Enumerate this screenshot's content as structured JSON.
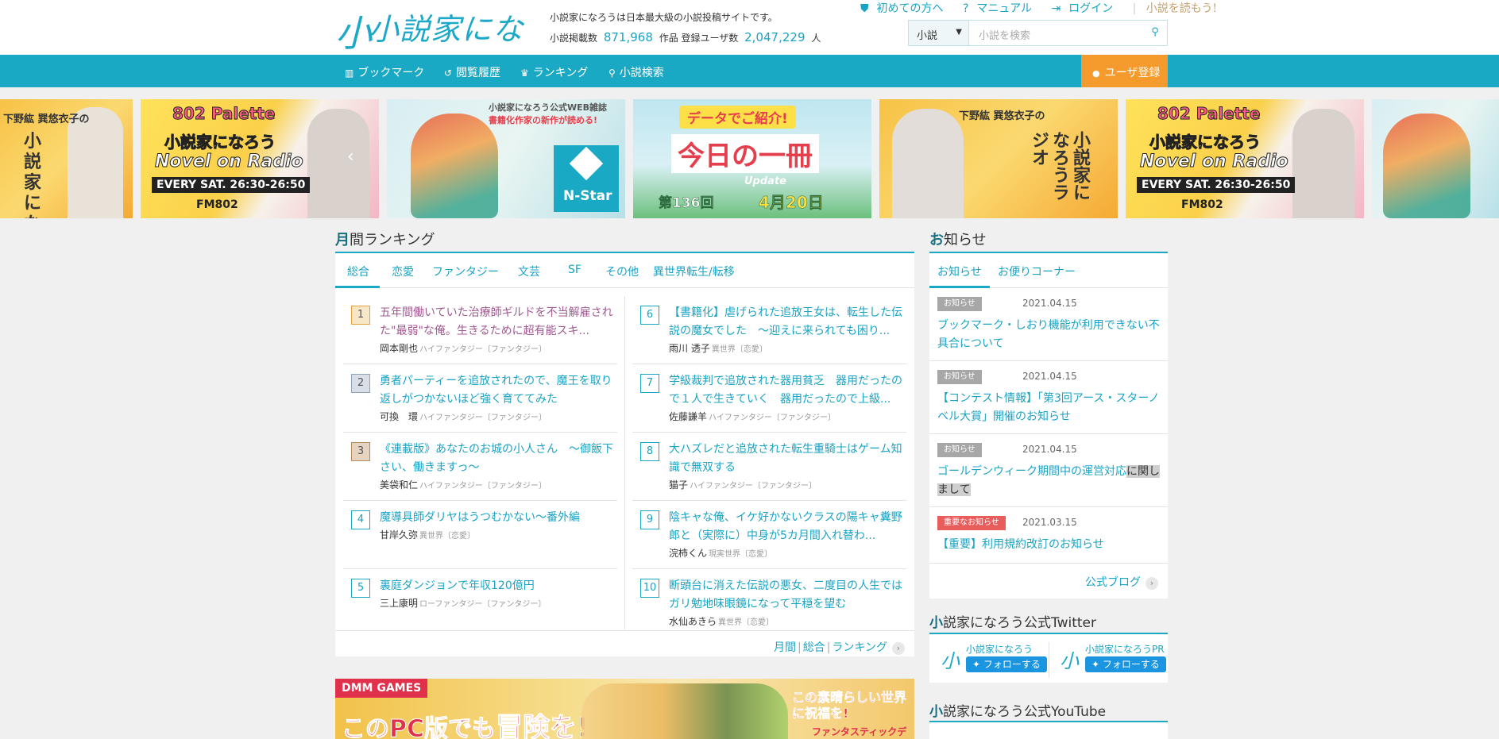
{
  "header": {
    "logo_text": "小説家になろう",
    "description": "小説家になろうは日本最大級の小説投稿サイトです。",
    "stats_novels_label": "小説掲載数",
    "stats_novels_value": "871,968",
    "stats_novels_unit": "作品",
    "stats_users_label": "登録ユーザ数",
    "stats_users_value": "2,047,229",
    "stats_users_unit": "人",
    "links": {
      "beginner": "初めての方へ",
      "manual": "マニュアル",
      "login": "ログイン",
      "read": "小説を読もう!"
    },
    "search": {
      "category": "小説",
      "placeholder": "小説を検索"
    }
  },
  "nav": {
    "bookmark": "ブックマーク",
    "history": "閲覧履歴",
    "ranking": "ランキング",
    "search": "小説検索",
    "register": "ユーザ登録"
  },
  "banners": {
    "radio_a": {
      "hosts": "下野紘 巽悠衣子の",
      "title": "小説家になろうラジオ"
    },
    "palette_a": {
      "brand": "802 Palette",
      "title": "小説家になろう",
      "subtitle": "Novel on Radio",
      "schedule": "EVERY SAT. 26:30-26:50",
      "station": "FM802"
    },
    "nstar": {
      "caption": "小説家になろう公式WEB雑誌",
      "caption2": "書籍化作家の新作が読める!",
      "brand": "N-Star"
    },
    "today": {
      "caption": "データでご紹介!",
      "title": "今日の一冊",
      "update": "Update",
      "issue": "第136回",
      "date": "4月20日"
    },
    "radio_b": {
      "hosts": "下野紘 巽悠衣子の",
      "title": "小説家になろうラジオ"
    },
    "palette_b": {
      "brand": "802 Palette",
      "title": "小説家になろう",
      "subtitle": "Novel on Radio",
      "schedule": "EVERY SAT. 26:30-26:50",
      "station": "FM802"
    }
  },
  "ranking": {
    "title_prefix": "月",
    "title_rest": "間ランキング",
    "tabs": [
      "総合",
      "恋愛",
      "ファンタジー",
      "文芸",
      "SF",
      "その他",
      "異世界転生/転移"
    ],
    "items": [
      {
        "rank": "1",
        "title": "五年間働いていた治療師ギルドを不当解雇された\"最弱\"な俺。生きるために超有能スキ...",
        "author": "岡本剛也",
        "genre": "ハイファンタジー〔ファンタジー〕"
      },
      {
        "rank": "2",
        "title": "勇者パーティーを追放されたので、魔王を取り返しがつかないほど強く育ててみた",
        "author": "可換　環",
        "genre": "ハイファンタジー〔ファンタジー〕"
      },
      {
        "rank": "3",
        "title": "《連載版》あなたのお城の小人さん　～御飯下さい、働きますっ～",
        "author": "美袋和仁",
        "genre": "ハイファンタジー〔ファンタジー〕"
      },
      {
        "rank": "4",
        "title": "魔導具師ダリヤはうつむかない～番外編",
        "author": "甘岸久弥",
        "genre": "異世界〔恋愛〕"
      },
      {
        "rank": "5",
        "title": "裏庭ダンジョンで年収120億円",
        "author": "三上康明",
        "genre": "ローファンタジー〔ファンタジー〕"
      },
      {
        "rank": "6",
        "title": "【書籍化】虐げられた追放王女は、転生した伝説の魔女でした　～迎えに来られても困り...",
        "author": "雨川 透子",
        "genre": "異世界〔恋愛〕"
      },
      {
        "rank": "7",
        "title": "学級裁判で追放された器用貧乏　器用だったので１人で生きていく　器用だったので上級...",
        "author": "佐藤謙羊",
        "genre": "ハイファンタジー〔ファンタジー〕"
      },
      {
        "rank": "8",
        "title": "大ハズレだと追放された転生重騎士はゲーム知識で無双する",
        "author": "猫子",
        "genre": "ハイファンタジー〔ファンタジー〕"
      },
      {
        "rank": "9",
        "title": "陰キャな俺、イケ好かないクラスの陽キャ糞野郎と（実際に）中身が5カ月間入れ替わ...",
        "author": "浣柿くん",
        "genre": "現実世界〔恋愛〕"
      },
      {
        "rank": "10",
        "title": "断頭台に消えた伝説の悪女、二度目の人生ではガリ勉地味眼鏡になって平穏を望む",
        "author": "水仙あきら",
        "genre": "異世界〔恋愛〕"
      }
    ],
    "more": {
      "a": "月間",
      "b": "総合",
      "c": "ランキング"
    }
  },
  "ad": {
    "brand": "DMM GAMES",
    "text1": "このPC版でも",
    "text2": "冒険を!",
    "text3": "この素晴らしい世界に祝福を!",
    "text4": "ファンタスティックデイズ"
  },
  "notices": {
    "title_prefix": "お",
    "title_rest": "知らせ",
    "tabs": [
      "お知らせ",
      "お便りコーナー"
    ],
    "items": [
      {
        "badge": "お知らせ",
        "date": "2021.04.15",
        "title": "ブックマーク・しおり機能が利用できない不具合について"
      },
      {
        "badge": "お知らせ",
        "date": "2021.04.15",
        "title": "【コンテスト情報】「第3回アース・スターノベル大賞」開催のお知らせ"
      },
      {
        "badge": "お知らせ",
        "date": "2021.04.15",
        "title_a": "ゴールデンウィーク期間中の運営対応",
        "title_b": "に関し",
        "title_c": "まして"
      },
      {
        "badge": "重要なお知らせ",
        "date": "2021.03.15",
        "title": "【重要】利用規約改訂のお知らせ"
      }
    ],
    "blog": "公式ブログ"
  },
  "twitter": {
    "title_prefix": "小",
    "title_rest": "説家になろう公式Twitter",
    "accounts": [
      {
        "name": "小説家になろう",
        "follow": "フォローする"
      },
      {
        "name": "小説家になろうPR",
        "follow": "フォローする"
      }
    ]
  },
  "youtube": {
    "title_prefix": "小",
    "title_rest": "説家になろう公式YouTube"
  },
  "colors": {
    "accent": "#1aa9c4",
    "register": "#f59a2c",
    "important": "#e85c5c"
  }
}
